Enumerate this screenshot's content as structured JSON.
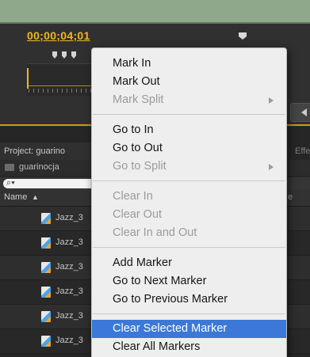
{
  "timeline": {
    "timecode": "00;00;04;01"
  },
  "project_panel": {
    "tab_label": "Project: guarino",
    "effects_tab_label": "Effe",
    "folder_label": "guarinocja",
    "search_prefix": "⌕▾",
    "name_header": "Name",
    "sort_arrow": "▲",
    "col_end_label": "e",
    "files": [
      "Jazz_3",
      "Jazz_3",
      "Jazz_3",
      "Jazz_3",
      "Jazz_3",
      "Jazz_3"
    ]
  },
  "context_menu": {
    "mark_in": "Mark In",
    "mark_out": "Mark Out",
    "mark_split": "Mark Split",
    "go_to_in": "Go to In",
    "go_to_out": "Go to Out",
    "go_to_split": "Go to Split",
    "clear_in": "Clear In",
    "clear_out": "Clear Out",
    "clear_in_and_out": "Clear In and Out",
    "add_marker": "Add Marker",
    "go_to_next_marker": "Go to Next Marker",
    "go_to_previous_marker": "Go to Previous Marker",
    "clear_selected_marker": "Clear Selected Marker",
    "clear_all_markers": "Clear All Markers"
  },
  "colors": {
    "accent_timecode": "#f0b71f",
    "menu_highlight": "#3b78d8",
    "menu_background": "#eeeeee"
  }
}
